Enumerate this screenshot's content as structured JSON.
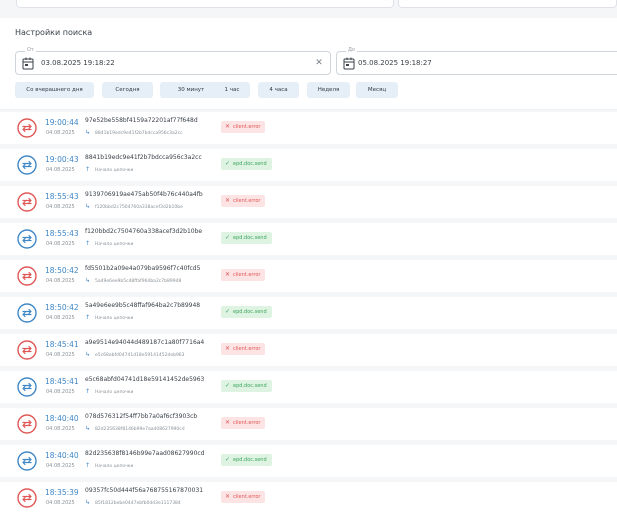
{
  "settings": {
    "title": "Настройки поиска",
    "from": {
      "label": "От",
      "value": "03.08.2025 19:18:22"
    },
    "to": {
      "label": "До",
      "value": "05.08.2025 19:18:27"
    },
    "presets": [
      "Со вчерашнего дня",
      "Сегодня",
      "30 минут",
      "1 час",
      "4 часа",
      "Неделя",
      "Месяц"
    ]
  },
  "rows": [
    {
      "time": "19:00:44",
      "date": "04.08.2025",
      "id": "97e52be558bf4159a72201af77f648d",
      "sub": "8841b19edc9e41f2b7bdcca956c3a2cc",
      "sub_kind": "link",
      "status": "client.error",
      "kind": "error"
    },
    {
      "time": "19:00:43",
      "date": "04.08.2025",
      "id": "8841b19edc9e41f2b7bdcca956c3a2cc",
      "sub": "Начало цепочки",
      "sub_kind": "start",
      "status": "epd.doc.send",
      "kind": "ok"
    },
    {
      "time": "18:55:43",
      "date": "04.08.2025",
      "id": "9139706919ae475ab50f4b76c440a4fb",
      "sub": "f120bbd2c7504760a338acef3d2b10be",
      "sub_kind": "link",
      "status": "client.error",
      "kind": "error"
    },
    {
      "time": "18:55:43",
      "date": "04.08.2025",
      "id": "f120bbd2c7504760a338acef3d2b10be",
      "sub": "Начало цепочки",
      "sub_kind": "start",
      "status": "epd.doc.send",
      "kind": "ok"
    },
    {
      "time": "18:50:42",
      "date": "04.08.2025",
      "id": "fd5501b2a09e4a079ba9596f7c40fcd5",
      "sub": "5a49e6ee9b5c48ffaf964ba2c7b89948",
      "sub_kind": "link",
      "status": "client.error",
      "kind": "error"
    },
    {
      "time": "18:50:42",
      "date": "04.08.2025",
      "id": "5a49e6ee9b5c48ffaf964ba2c7b89948",
      "sub": "Начало цепочки",
      "sub_kind": "start",
      "status": "epd.doc.send",
      "kind": "ok"
    },
    {
      "time": "18:45:41",
      "date": "04.08.2025",
      "id": "a9e9514e94044d489187c1a80f7716a4",
      "sub": "e5c68abfd04741d18e59141452deb963",
      "sub_kind": "link",
      "status": "client.error",
      "kind": "error"
    },
    {
      "time": "18:45:41",
      "date": "04.08.2025",
      "id": "e5c68abfd04741d18e59141452de5963",
      "sub": "Начало цепочки",
      "sub_kind": "start",
      "status": "epd.doc.send",
      "kind": "ok"
    },
    {
      "time": "18:40:40",
      "date": "04.08.2025",
      "id": "078d576312f54ff7bb7a0af6cf3903cb",
      "sub": "82d235638f8146b99e7aad08627990cd",
      "sub_kind": "link",
      "status": "client.error",
      "kind": "error"
    },
    {
      "time": "18:40:40",
      "date": "04.08.2025",
      "id": "82d235638f8146b99e7aad08627990cd",
      "sub": "Начало цепочки",
      "sub_kind": "start",
      "status": "epd.doc.send",
      "kind": "ok"
    },
    {
      "time": "18:35:39",
      "date": "04.08.2025",
      "id": "09357fc50d444f56a768755167870031",
      "sub": "85f1812bebe0447ebfb0dd3e1117384",
      "sub_kind": "link",
      "status": "client.error",
      "kind": "error"
    }
  ],
  "colors": {
    "accent": "#3f87c7",
    "error": "#e05656",
    "ok": "#3aa55c"
  }
}
